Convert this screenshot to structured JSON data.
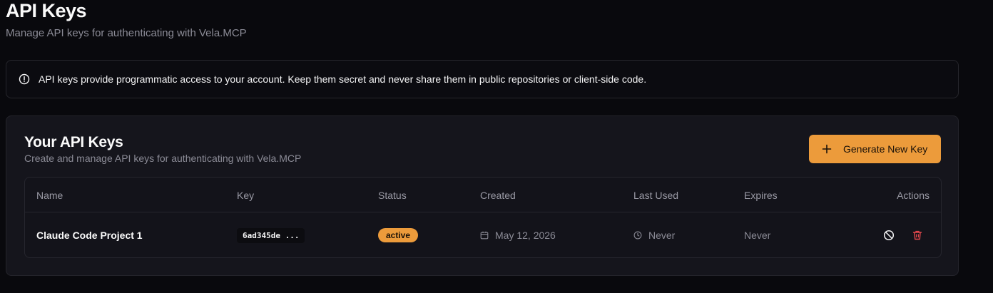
{
  "header": {
    "title": "API Keys",
    "subtitle": "Manage API keys for authenticating with Vela.MCP"
  },
  "alert": {
    "icon": "info-circle-icon",
    "text": "API keys provide programmatic access to your account. Keep them secret and never share them in public repositories or client-side code."
  },
  "card": {
    "title": "Your API Keys",
    "subtitle": "Create and manage API keys for authenticating with Vela.MCP",
    "generate_label": "Generate New Key"
  },
  "table": {
    "columns": [
      "Name",
      "Key",
      "Status",
      "Created",
      "Last Used",
      "Expires",
      "Actions"
    ],
    "rows": [
      {
        "name": "Claude Code Project 1",
        "key": "6ad345de ...",
        "status": "active",
        "created": "May 12, 2026",
        "last_used": "Never",
        "expires": "Never"
      }
    ]
  },
  "colors": {
    "accent": "#ec9b3b",
    "danger": "#e5484d",
    "background": "#09090d",
    "card": "#15151c"
  }
}
